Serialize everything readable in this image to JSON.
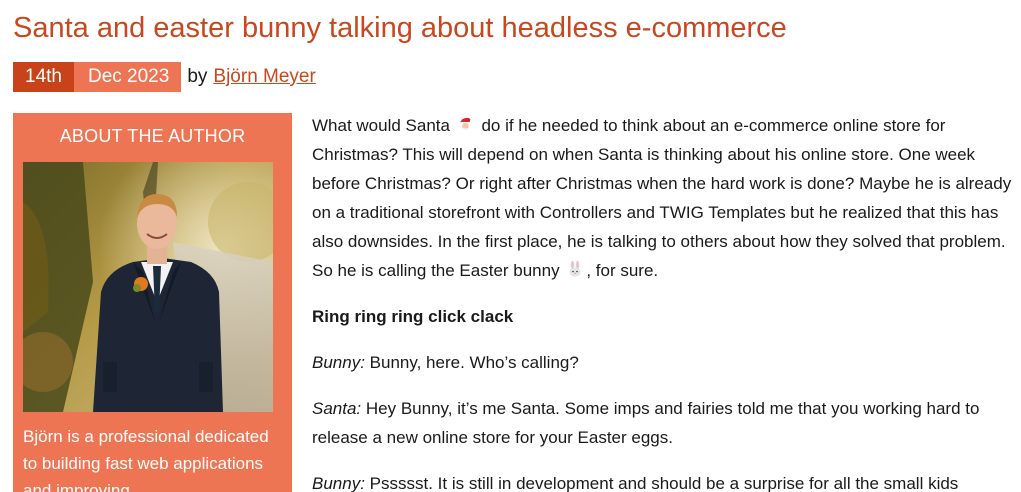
{
  "post": {
    "title": "Santa and easter bunny talking about headless e-commerce",
    "date_day": "14th",
    "date_month": "Dec 2023",
    "by_label": "by",
    "author_name": "Björn Meyer"
  },
  "sidebar": {
    "heading": "ABOUT THE AUTHOR",
    "bio": "Björn is a professional dedicated to building fast web applications and improving"
  },
  "content": {
    "intro_part1": "What would Santa",
    "intro_part2": "do if he needed to think about an e-commerce online store for Christmas? This will depend on when Santa is thinking about his online store. One week before Christmas? Or right after Christmas when the hard work is done? Maybe he is already on a traditional storefront with Controllers and TWIG Templates but he realized that this has also downsides. In the first place, he is talking to others about how they solved that problem. So he is calling the Easter bunny",
    "intro_part3": ", for sure.",
    "ring": "Ring ring ring click clack",
    "dialogue": [
      {
        "speaker": "Bunny:",
        "text": " Bunny, here. Who’s calling?"
      },
      {
        "speaker": "Santa:",
        "text": " Hey Bunny, it’s me Santa. Some imps and fairies told me that you working hard to release a new online store for your Easter eggs."
      },
      {
        "speaker": "Bunny:",
        "text": " Pssssst. It is still in development and should be a surprise for all the small kids"
      }
    ]
  },
  "icons": {
    "santa": "santa-emoji-icon",
    "bunny": "rabbit-emoji-icon"
  },
  "colors": {
    "accent": "#c8471e",
    "accent_dark": "#c8421a",
    "accent_light": "#ee7553",
    "text": "#1a1a1a"
  }
}
